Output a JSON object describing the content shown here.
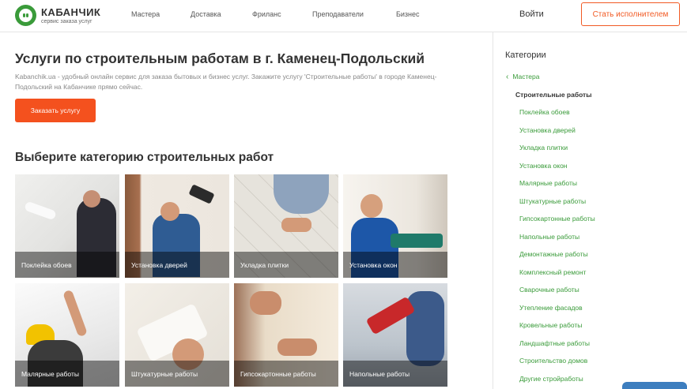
{
  "header": {
    "logo_name": "КАБАНЧИК",
    "logo_sub": "сервис заказа услуг",
    "nav": [
      "Мастера",
      "Доставка",
      "Фриланс",
      "Преподаватели",
      "Бизнес"
    ],
    "login": "Войти",
    "cta": "Стать исполнителем"
  },
  "main": {
    "title": "Услуги по строительным работам в г. Каменец-Подольский",
    "description": "Kabanchik.ua - удобный онлайн сервис для заказа бытовых и бизнес услуг. Закажите услугу 'Строительные работы' в городе Каменец-Подольский на Кабанчике прямо сейчас.",
    "order_button": "Заказать услугу",
    "section_title": "Выберите категорию строительных работ",
    "tiles": [
      "Поклейка обоев",
      "Установка дверей",
      "Укладка плитки",
      "Установка окон",
      "Малярные работы",
      "Штукатурные работы",
      "Гипсокартонные работы",
      "Напольные работы"
    ]
  },
  "sidebar": {
    "title": "Категории",
    "back": "Мастера",
    "current": "Строительные работы",
    "items": [
      "Поклейка обоев",
      "Установка дверей",
      "Укладка плитки",
      "Установка окон",
      "Малярные работы",
      "Штукатурные работы",
      "Гипсокартонные работы",
      "Напольные работы",
      "Демонтажные работы",
      "Комплексный ремонт",
      "Сварочные работы",
      "Утепление фасадов",
      "Кровельные работы",
      "Ландшафтные работы",
      "Строительство домов",
      "Другие стройработы"
    ]
  },
  "colors": {
    "brand_green": "#3a9b3a",
    "accent_orange": "#f4511e"
  }
}
